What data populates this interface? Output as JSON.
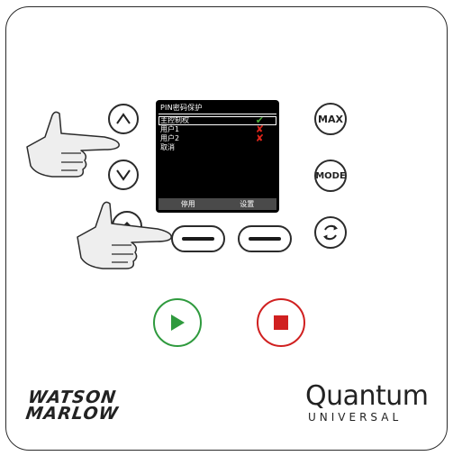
{
  "screen": {
    "title": "PIN密码保护",
    "menu": [
      {
        "label": "主控制权",
        "status": "✔",
        "status_type": "enabled",
        "selected": true
      },
      {
        "label": "用户1",
        "status": "✘",
        "status_type": "disabled",
        "selected": false
      },
      {
        "label": "用户2",
        "status": "✘",
        "status_type": "disabled",
        "selected": false
      },
      {
        "label": "取消",
        "status": "",
        "status_type": "none",
        "selected": false
      }
    ],
    "softkey_left": "停用",
    "softkey_right": "设置"
  },
  "buttons": {
    "max_label": "MAX",
    "mode_label": "MODE"
  },
  "branding": {
    "watson_marlow_line1": "WATSON",
    "watson_marlow_line2": "MARLOW",
    "quantum": "Quantum",
    "universal": "UNIVERSAL"
  },
  "colors": {
    "play": "#2f9a3e",
    "stop": "#d02020",
    "enabled_mark": "#4caf3a",
    "disabled_mark": "#e0261b",
    "screen_bg": "#000000",
    "softbar_bg": "#4a4a4a"
  }
}
